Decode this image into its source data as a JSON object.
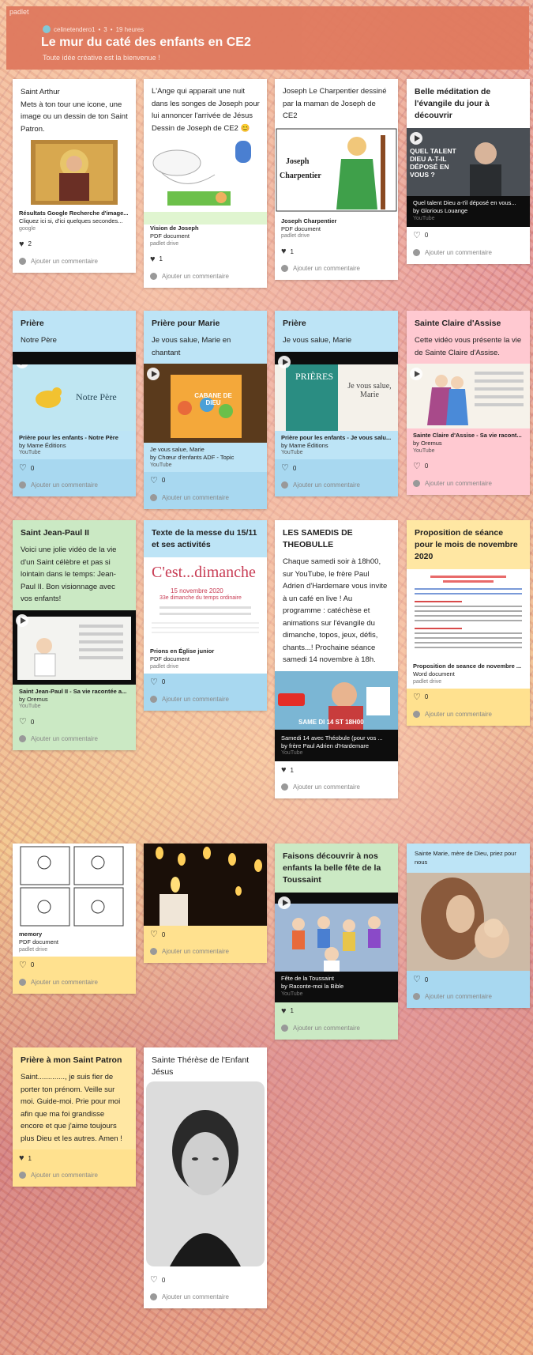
{
  "header": {
    "brand": "padlet",
    "author": "celinetendero1",
    "count": "3",
    "time": "19 heures",
    "title": "Le mur du caté des enfants en CE2",
    "subtitle": "Toute idée créative est la bienvenue !"
  },
  "comment_label": "Ajouter un commentaire",
  "cards": {
    "c1": {
      "title": "Saint Arthur",
      "body": "Mets à ton tour une icone, une image ou un dessin de ton Saint Patron.",
      "att_title": "Résultats Google Recherche d'image...",
      "att_line": "Cliquez ici si, d'ici quelques secondes...",
      "att_src": "google",
      "likes": "2"
    },
    "c2": {
      "body": "L'Ange qui apparait une nuit dans les songes de Joseph pour lui annoncer l'arrivée de Jésus Dessin de Joseph de CE2 😊",
      "att_title": "Vision de Joseph",
      "att_line": "PDF document",
      "att_src": "padlet drive",
      "likes": "1"
    },
    "c3": {
      "body": "Joseph Le Charpentier dessiné par la maman de Joseph de CE2",
      "img_text1": "Joseph",
      "img_text2": "Charpentier",
      "att_title": "Joseph Charpentier",
      "att_line": "PDF document",
      "att_src": "padlet drive",
      "likes": "1"
    },
    "c4": {
      "title": "Belle méditation de l'évangile du jour à découvrir",
      "img_text": "QUEL TALENT DIEU A-T-IL DÉPOSÉ EN VOUS ?",
      "att_title": "Quel talent Dieu a-t'il déposé en vous...",
      "att_line": "by Glorious Louange",
      "att_src": "YouTube",
      "likes": "0"
    },
    "c5": {
      "title": "Prière",
      "body": "Notre Père",
      "img_text": "Notre Père",
      "att_title": "Prière pour les enfants - Notre Père",
      "att_line": "by Mame Éditions",
      "att_src": "YouTube",
      "likes": "0"
    },
    "c6": {
      "title": "Prière pour Marie",
      "body": "Je vous salue, Marie en chantant",
      "img_text": "CABANE DE DIEU",
      "att_title": "Je vous salue, Marie",
      "att_line": "by Chœur d'enfants ADF - Topic",
      "att_src": "YouTube",
      "likes": "0"
    },
    "c7": {
      "title": "Prière",
      "body": "Je vous salue, Marie",
      "img_text1": "PRIÈRES",
      "img_text2": "Je vous salue, Marie",
      "att_title": "Prière pour les enfants - Je vous salu...",
      "att_line": "by Mame Éditions",
      "att_src": "YouTube",
      "likes": "0"
    },
    "c8": {
      "title": "Sainte Claire d'Assise",
      "body": "Cette vidéo vous présente la vie de Sainte Claire d'Assise.",
      "att_title": "Sainte Claire d'Assise - Sa vie racont...",
      "att_line": "by Oremus",
      "att_src": "YouTube",
      "likes": "0"
    },
    "c9": {
      "title": "Saint Jean-Paul II",
      "body": "Voici une jolie vidéo de la vie d'un Saint célèbre et pas si lointain dans le temps: Jean-Paul II. Bon visionnage avec vos enfants!",
      "att_title": "Saint Jean-Paul II - Sa vie racontée a...",
      "att_line": "by Oremus",
      "att_src": "YouTube",
      "likes": "0"
    },
    "c10": {
      "title": "Texte de la messe du 15/11 et ses activités",
      "img_text1": "C'est...dimanche",
      "img_text2": "15 novembre 2020",
      "img_text3": "33e dimanche du temps ordinaire",
      "att_title": "Prions en Église junior",
      "att_line": "PDF document",
      "att_src": "padlet drive",
      "likes": "0"
    },
    "c11": {
      "title": "LES SAMEDIS DE THEOBULLE",
      "body": "Chaque samedi soir à 18h00, sur YouTube, le frère Paul Adrien d'Hardemare vous invite à un café en live ! Au programme : catéchèse et animations sur l'évangile du dimanche, topos, jeux, défis, chants...! Prochaine séance samedi 14 novembre à 18h.",
      "img_text": "SAME DI 14 ST 18H00",
      "att_title": "Samedi 14 avec Théobule (pour vos ...",
      "att_line": "by frère Paul Adrien d'Hardemare",
      "att_src": "YouTube",
      "likes": "1"
    },
    "c12": {
      "title": "Proposition de séance pour le mois de novembre 2020",
      "att_title": "Proposition de seance de novembre ...",
      "att_line": "Word document",
      "att_src": "padlet drive",
      "likes": "0"
    },
    "c13": {
      "att_title": "memory",
      "att_line": "PDF document",
      "att_src": "padlet drive",
      "likes": "0"
    },
    "c14": {
      "likes": "0"
    },
    "c15": {
      "title": "Faisons découvrir à nos enfants la belle fête de la Toussaint",
      "att_title": "Fête de la Toussaint",
      "att_line": "by Raconte-moi la Bible",
      "att_src": "YouTube",
      "likes": "1"
    },
    "c16": {
      "body": "Sainte Marie, mère de Dieu, priez pour nous",
      "likes": "0"
    },
    "c17": {
      "title": "Prière à mon Saint Patron",
      "body": "Saint............., je suis fier de porter ton prénom. Veille sur moi. Guide-moi. Prie pour moi afin que ma foi grandisse encore et que j'aime toujours plus Dieu et les autres. Amen !",
      "likes": "1"
    },
    "c18": {
      "title": "Sainte Thérèse de l'Enfant Jésus",
      "likes": "0"
    }
  },
  "colors": {
    "header": "#e07a5f",
    "blue": "#bde4f6",
    "pink": "#ffc9d1",
    "green": "#cbe9c4",
    "yellow": "#ffe7a3"
  }
}
